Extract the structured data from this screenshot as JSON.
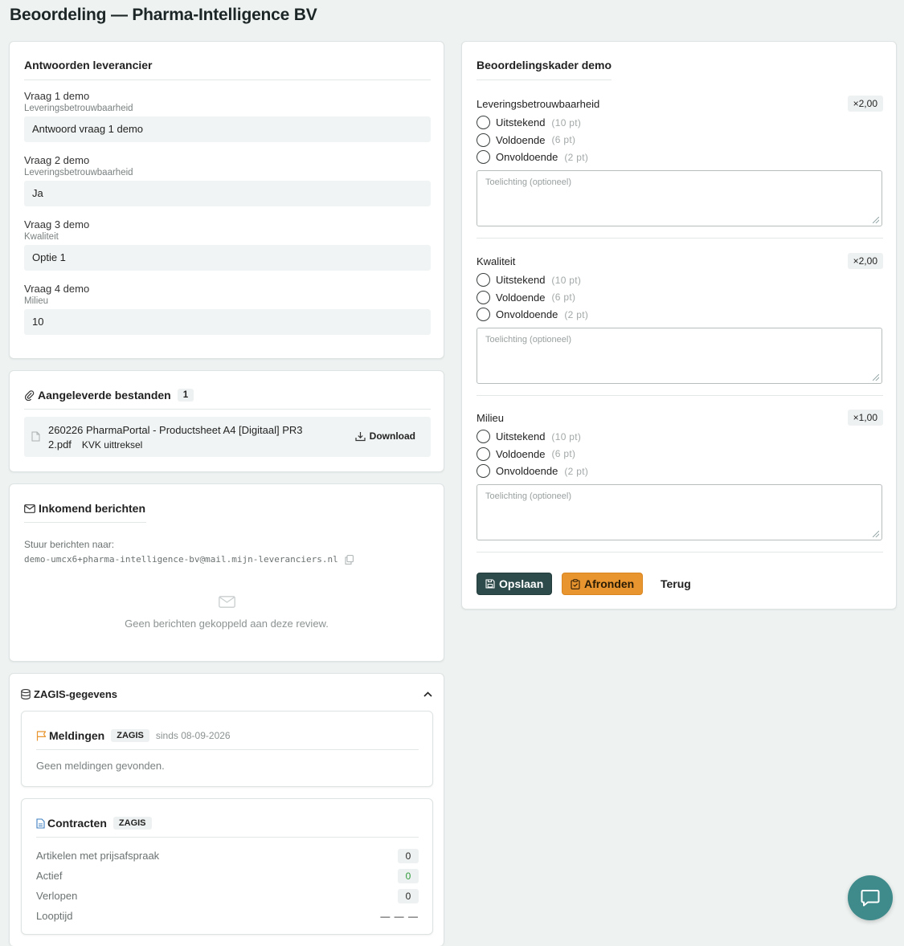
{
  "page": {
    "title": "Beoordeling — Pharma-Intelligence BV"
  },
  "answers": {
    "title": "Antwoorden leverancier",
    "items": [
      {
        "question": "Vraag 1 demo",
        "category": "Leveringsbetrouwbaarheid",
        "answer": "Antwoord vraag 1 demo"
      },
      {
        "question": "Vraag 2 demo",
        "category": "Leveringsbetrouwbaarheid",
        "answer": "Ja"
      },
      {
        "question": "Vraag 3 demo",
        "category": "Kwaliteit",
        "answer": "Optie 1"
      },
      {
        "question": "Vraag 4 demo",
        "category": "Milieu",
        "answer": "10"
      }
    ]
  },
  "files": {
    "title": "Aangeleverde bestanden",
    "count": "1",
    "items": [
      {
        "name_line1": "260226 PharmaPortal - Productsheet A4 [Digitaal] PR3",
        "name_line2": "2.pdf",
        "type": "KVK uittreksel",
        "download_label": "Download"
      }
    ]
  },
  "messages": {
    "title": "Inkomend berichten",
    "send_to_label": "Stuur berichten naar:",
    "email": "demo-umcx6+pharma-intelligence-bv@mail.mijn-leveranciers.nl",
    "empty_text": "Geen berichten gekoppeld aan deze review."
  },
  "zagis": {
    "title": "ZAGIS-gegevens",
    "meldingen": {
      "title": "Meldingen",
      "badge": "ZAGIS",
      "since": "sinds 08-09-2026",
      "empty_text": "Geen meldingen gevonden."
    },
    "contracten": {
      "title": "Contracten",
      "badge": "ZAGIS",
      "rows": [
        {
          "label": "Artikelen met prijsafspraak",
          "value": "0",
          "color": "#222222"
        },
        {
          "label": "Actief",
          "value": "0",
          "color": "#2e9a3a"
        },
        {
          "label": "Verlopen",
          "value": "0",
          "color": "#222222"
        },
        {
          "label": "Looptijd",
          "value": "— — —",
          "color": "#222222"
        }
      ]
    }
  },
  "framework": {
    "title": "Beoordelingskader demo",
    "criteria": [
      {
        "name": "Leveringsbetrouwbaarheid",
        "weight": "×2,00",
        "options": [
          {
            "label": "Uitstekend",
            "points": "(10 pt)"
          },
          {
            "label": "Voldoende",
            "points": "(6 pt)"
          },
          {
            "label": "Onvoldoende",
            "points": "(2 pt)"
          }
        ],
        "placeholder": "Toelichting (optioneel)"
      },
      {
        "name": "Kwaliteit",
        "weight": "×2,00",
        "options": [
          {
            "label": "Uitstekend",
            "points": "(10 pt)"
          },
          {
            "label": "Voldoende",
            "points": "(6 pt)"
          },
          {
            "label": "Onvoldoende",
            "points": "(2 pt)"
          }
        ],
        "placeholder": "Toelichting (optioneel)"
      },
      {
        "name": "Milieu",
        "weight": "×1,00",
        "options": [
          {
            "label": "Uitstekend",
            "points": "(10 pt)"
          },
          {
            "label": "Voldoende",
            "points": "(6 pt)"
          },
          {
            "label": "Onvoldoende",
            "points": "(2 pt)"
          }
        ],
        "placeholder": "Toelichting (optioneel)"
      }
    ],
    "buttons": {
      "save": "Opslaan",
      "finish": "Afronden",
      "back": "Terug"
    }
  },
  "colors": {
    "primary": "#2e4b4b",
    "accent": "#e8952f",
    "chat": "#3f8a8a"
  },
  "icons": [
    "paperclip-icon",
    "file-icon",
    "download-icon",
    "mail-icon",
    "copy-icon",
    "database-icon",
    "chevron-up-icon",
    "flag-icon",
    "document-icon",
    "save-icon",
    "clipboard-check-icon",
    "chat-icon"
  ]
}
